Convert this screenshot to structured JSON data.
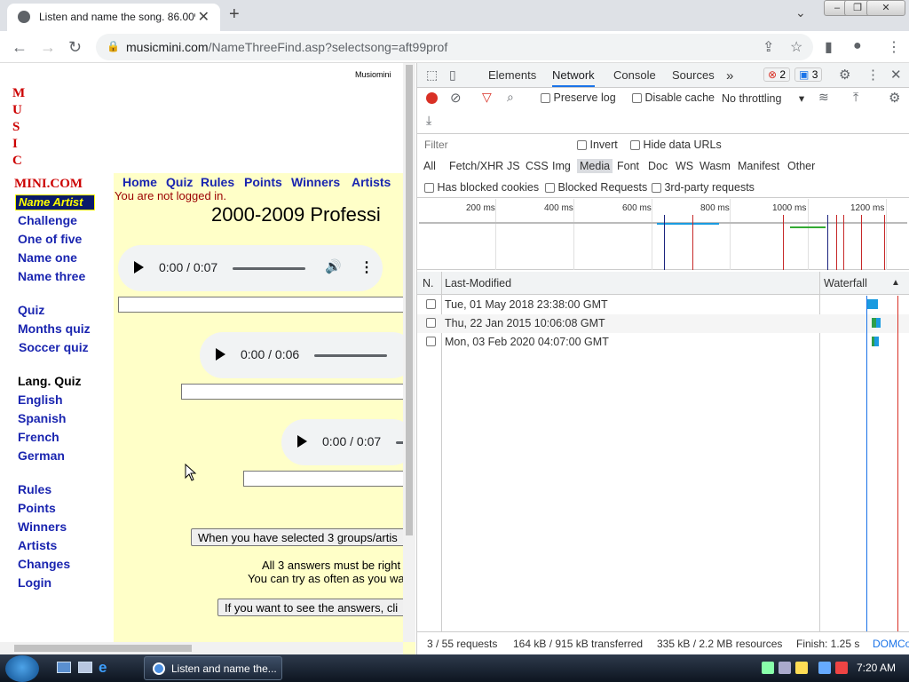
{
  "browser": {
    "tab_title": "Listen and name the song. 86.00%",
    "url_domain": "musicmini.com",
    "url_path": "/NameThreeFind.asp?selectsong=aft99prof"
  },
  "page": {
    "logo_corner": "Musiomini",
    "logo_letters": [
      "M",
      "U",
      "S",
      "I",
      "C"
    ],
    "logo_tail": "MINI.COM",
    "name_artist": "Name Artist",
    "left_nav_group1": [
      "Challenge",
      "One of five",
      "Name one",
      "Name three"
    ],
    "left_nav_group2": [
      "Quiz",
      "Months quiz",
      "Soccer quiz"
    ],
    "lang_heading": "Lang. Quiz",
    "left_nav_group3": [
      "English",
      "Spanish",
      "French",
      "German"
    ],
    "left_nav_group4": [
      "Rules",
      "Points",
      "Winners",
      "Artists",
      "Changes",
      "Login"
    ],
    "top_nav": [
      "Home",
      "Quiz",
      "Rules",
      "Points",
      "Winners",
      "Artists"
    ],
    "not_logged": "You are not logged in.",
    "heading": "2000-2009 Professi",
    "players": [
      {
        "time": "0:00 / 0:07"
      },
      {
        "time": "0:00 / 0:06"
      },
      {
        "time": "0:00 / 0:07"
      }
    ],
    "select_button": "When you have selected 3 groups/artis",
    "rule_line1": "All 3 answers must be right",
    "rule_line2": "You can try as often as you wa",
    "answers_button": "If you want to see the answers, cli"
  },
  "devtools": {
    "tabs": [
      "Elements",
      "Network",
      "Console",
      "Sources"
    ],
    "active_tab": "Network",
    "errors": "2",
    "messages": "3",
    "preserve_log": "Preserve log",
    "disable_cache": "Disable cache",
    "throttling": "No throttling",
    "filter_placeholder": "Filter",
    "invert": "Invert",
    "hide_data_urls": "Hide data URLs",
    "types": [
      "All",
      "Fetch/XHR",
      "JS",
      "CSS",
      "Img",
      "Media",
      "Font",
      "Doc",
      "WS",
      "Wasm",
      "Manifest",
      "Other"
    ],
    "active_type": "Media",
    "has_blocked_cookies": "Has blocked cookies",
    "blocked_requests": "Blocked Requests",
    "third_party": "3rd-party requests",
    "ticks": [
      "200 ms",
      "400 ms",
      "600 ms",
      "800 ms",
      "1000 ms",
      "1200 ms"
    ],
    "col_n": "N.",
    "col_modified": "Last-Modified",
    "col_waterfall": "Waterfall",
    "rows": [
      {
        "modified": "Tue, 01 May 2018 23:38:00 GMT"
      },
      {
        "modified": "Thu, 22 Jan 2015 10:06:08 GMT"
      },
      {
        "modified": "Mon, 03 Feb 2020 04:07:00 GMT"
      }
    ],
    "status": {
      "requests": "3 / 55 requests",
      "transferred": "164 kB / 915 kB transferred",
      "resources": "335 kB / 2.2 MB resources",
      "finish": "Finish: 1.25 s",
      "domc": "DOMCo"
    }
  },
  "taskbar": {
    "item": "Listen and name the...",
    "time": "7:20 AM"
  },
  "colors": {
    "link": "#1a25b0",
    "logo": "#cc0000",
    "page_bg": "#ffffc8",
    "record": "#d93025"
  }
}
